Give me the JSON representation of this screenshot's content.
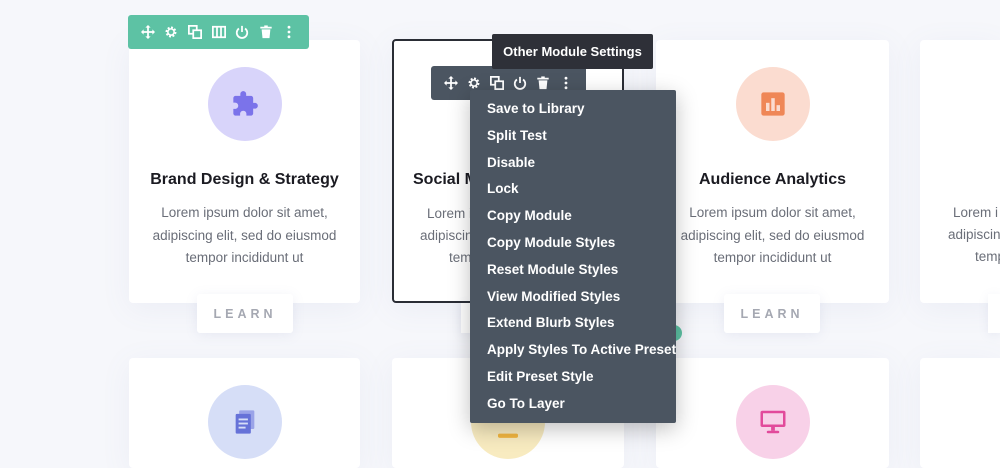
{
  "cards": [
    {
      "title": "Brand Design & Strategy",
      "body": "Lorem ipsum dolor sit amet, adipiscing elit, sed do eiusmod tempor incididunt ut",
      "button": "LEARN",
      "icon": "puzzle-icon",
      "icon_bg": "#d8d4fa",
      "icon_color": "#7b73ea"
    },
    {
      "title": "Social M",
      "body_line1": "Lorem i",
      "body_line2": "adipiscing",
      "body_line3": "tem"
    },
    {
      "title": "Audience Analytics",
      "body": "Lorem ipsum dolor sit amet, adipiscing elit, sed do eiusmod tempor incididunt ut",
      "button": "LEARN",
      "icon": "bar-chart-icon",
      "icon_bg": "#fbdcd0",
      "icon_color": "#ef8757"
    },
    {
      "body_line1": "Lorem i",
      "body_line2": "adipiscin",
      "body_line3": "temp"
    }
  ],
  "bottom_cards": [
    {
      "icon": "documents-icon",
      "icon_bg": "#d6def7",
      "icon_color": "#6672d8"
    },
    {
      "icon": "lamp-icon",
      "icon_bg": "#f8ebc0",
      "icon_color": "#f2b640"
    },
    {
      "icon": "monitor-icon",
      "icon_bg": "#f8d1e8",
      "icon_color": "#e24a9b"
    }
  ],
  "row_toolbar": {
    "bg": "#5dc2a4",
    "icons": [
      "move-icon",
      "gear-icon",
      "duplicate-icon",
      "columns-icon",
      "power-icon",
      "trash-icon",
      "more-icon"
    ]
  },
  "module_toolbar": {
    "bg": "#4b5561",
    "icons": [
      "move-icon",
      "gear-icon",
      "duplicate-icon",
      "power-icon",
      "trash-icon",
      "more-icon"
    ]
  },
  "tooltip": "Other Module Settings",
  "menu": {
    "items": [
      "Save to Library",
      "Split Test",
      "Disable",
      "Lock",
      "Copy Module",
      "Copy Module Styles",
      "Reset Module Styles",
      "View Modified Styles",
      "Extend Blurb Styles",
      "Apply Styles To Active Preset",
      "Edit Preset Style",
      "Go To Layer"
    ]
  }
}
